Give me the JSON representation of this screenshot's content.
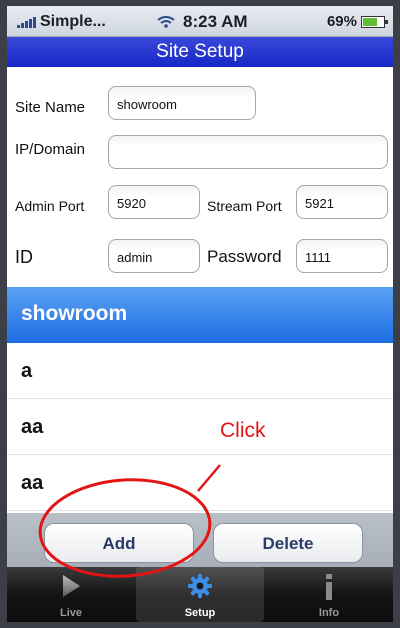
{
  "status": {
    "carrier": "Simple...",
    "time": "8:23 AM",
    "battery": "69%"
  },
  "nav": {
    "title": "Site Setup"
  },
  "form": {
    "site_name_label": "Site Name",
    "site_name_value": "showroom",
    "ip_label": "IP/Domain",
    "ip_value": "",
    "admin_port_label": "Admin Port",
    "admin_port_value": "5920",
    "stream_port_label": "Stream Port",
    "stream_port_value": "5921",
    "id_label": "ID",
    "id_value": "admin",
    "password_label": "Password",
    "password_value": "1111"
  },
  "list": {
    "items": [
      "showroom",
      "a",
      "aa",
      "aa"
    ],
    "selected_index": 0
  },
  "buttons": {
    "add": "Add",
    "delete": "Delete"
  },
  "tabs": [
    {
      "label": "Live",
      "icon": "play-icon"
    },
    {
      "label": "Setup",
      "icon": "gear-icon"
    },
    {
      "label": "Info",
      "icon": "info-icon"
    }
  ],
  "active_tab": "Setup",
  "annotation": {
    "text": "Click",
    "color": "#e31414"
  },
  "colors": {
    "nav": "#1f30cf",
    "selected_row": "#2f7fe9"
  }
}
